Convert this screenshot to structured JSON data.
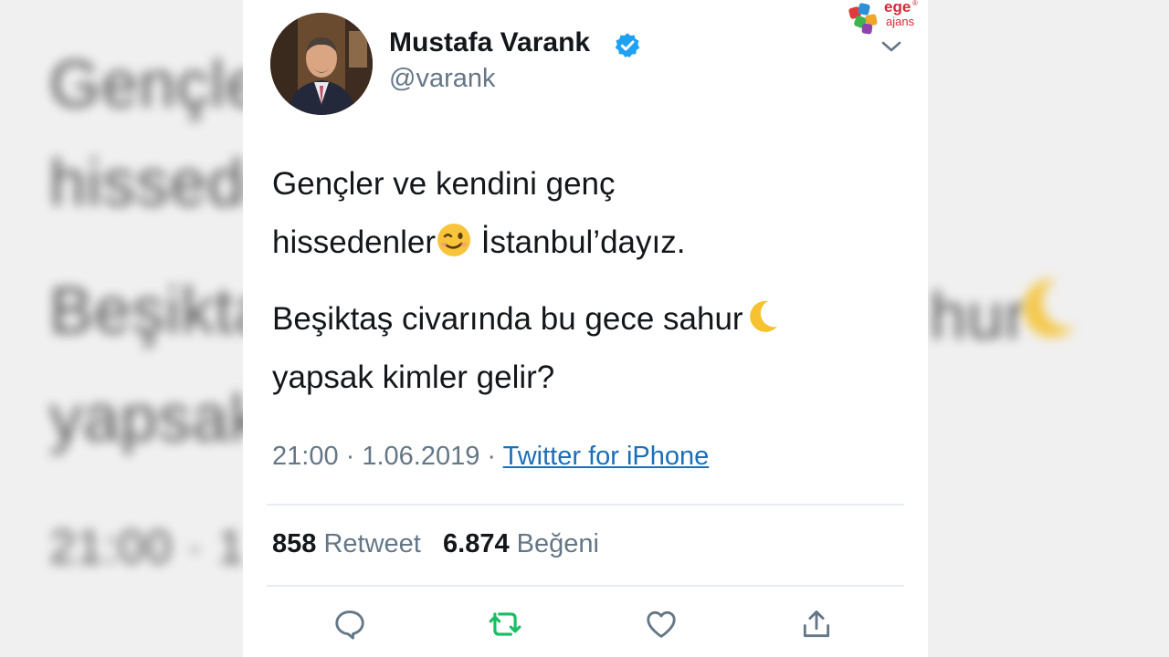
{
  "background": {
    "lines": [
      "Gençle",
      "hissedе",
      "Beşikta",
      "yapsak",
      "21:00 · 1"
    ],
    "line_end": "hur"
  },
  "watermark": {
    "top": "ege",
    "bottom": "ajans",
    "mark": "®"
  },
  "tweet": {
    "author_name": "Mustafa Varank",
    "handle": "@varank",
    "paragraph1_part1": "Gençler ve kendini genç",
    "paragraph1_part2": "hissedenler",
    "paragraph1_part3": " İstanbul’dayız.",
    "paragraph2_part1": "Beşiktaş civarında bu gece sahur",
    "paragraph2_part2": "yapsak kimler gelir?",
    "time": "21:00",
    "separator": " · ",
    "date": "1.06.2019",
    "source": "Twitter for iPhone",
    "retweet_count": "858",
    "retweet_label": "Retweet",
    "like_count": "6.874",
    "like_label": "Beğeni"
  },
  "colors": {
    "retweet_icon": "#17bf63",
    "verified": "#1da1f2",
    "muted": "#657786",
    "link": "#1b6fb8"
  },
  "icons": {
    "reply": "reply-icon",
    "retweet": "retweet-icon",
    "like": "heart-icon",
    "share": "share-icon"
  }
}
